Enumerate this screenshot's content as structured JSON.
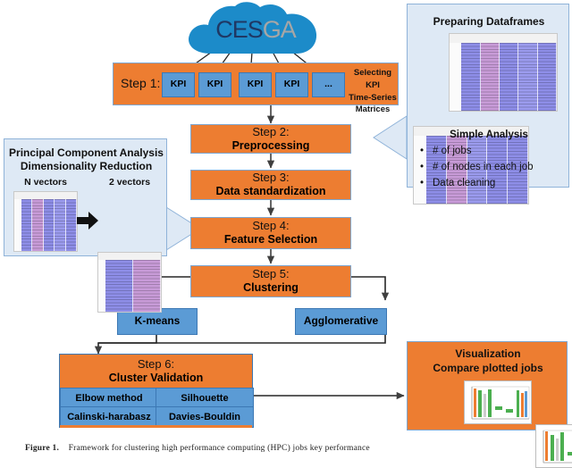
{
  "figure": {
    "caption_label": "Figure 1.",
    "caption_text": "Framework for clustering high performance computing (HPC) jobs key performance"
  },
  "cloud": {
    "name": "CESGA",
    "part1": "CES",
    "part2": "GA",
    "color": "#1C8BC9",
    "text_color_1": "#1F3864",
    "text_color_2": "#A6A6A6"
  },
  "colors": {
    "orange": "#ED7D31",
    "blue": "#5B9BD5",
    "light_blue_panel": "#DEE9F5",
    "panel_border": "#8FB3D9",
    "arrow": "#3F3F3F"
  },
  "step1": {
    "label": "Step 1:",
    "kpis": [
      "KPI",
      "KPI",
      "KPI",
      "KPI",
      "..."
    ],
    "note_line1": "Selecting KPI",
    "note_line2": "Time-Series",
    "note_line3": "Matrices"
  },
  "steps": [
    {
      "title": "Step 2:",
      "subtitle": "Preprocessing"
    },
    {
      "title": "Step 3:",
      "subtitle": "Data standardization"
    },
    {
      "title": "Step 4:",
      "subtitle": "Feature Selection"
    },
    {
      "title": "Step 5:",
      "subtitle": "Clustering"
    }
  ],
  "algorithms": [
    {
      "label": "K-means"
    },
    {
      "label": "Agglomerative"
    }
  ],
  "step6": {
    "title": "Step 6:",
    "subtitle": "Cluster Validation",
    "metrics": [
      "Elbow method",
      "Silhouette",
      "Calinski-harabasz",
      "Davies-Bouldin"
    ]
  },
  "panel_dataframes": {
    "title": "Preparing Dataframes",
    "subtitle": "Simple Analysis",
    "bullets": [
      "# of jobs",
      "# of nodes in each job",
      "Data cleaning"
    ]
  },
  "panel_pca": {
    "title_line1": "Principal Component Analysis",
    "title_line2": "Dimensionality Reduction",
    "left_label": "N vectors",
    "right_label": "2 vectors",
    "arrow_glyph": "➡"
  },
  "panel_visualization": {
    "title_line1": "Visualization",
    "title_line2": "Compare plotted jobs"
  }
}
